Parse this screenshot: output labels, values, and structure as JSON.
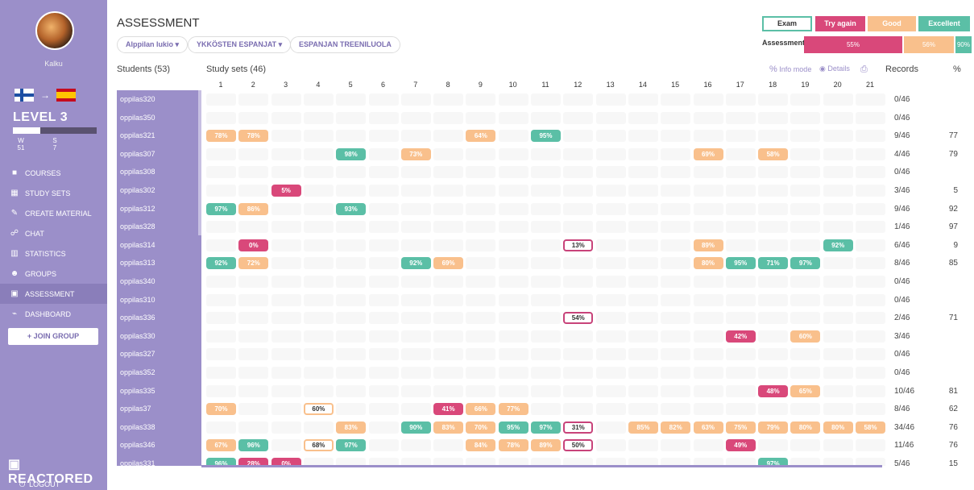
{
  "sidebar": {
    "username": "Kalku",
    "level": "LEVEL 3",
    "w_label": "W",
    "w_value": "51",
    "s_label": "S",
    "s_value": "7",
    "level_progress": 0.33,
    "menu": [
      {
        "label": "COURSES",
        "icon": "courses-icon",
        "glyph": "■"
      },
      {
        "label": "STUDY SETS",
        "icon": "study-sets-icon",
        "glyph": "▦"
      },
      {
        "label": "CREATE MATERIAL",
        "icon": "pencil-icon",
        "glyph": "✎"
      },
      {
        "label": "CHAT",
        "icon": "chat-icon",
        "glyph": "☍"
      },
      {
        "label": "STATISTICS",
        "icon": "statistics-icon",
        "glyph": "▥"
      },
      {
        "label": "GROUPS",
        "icon": "groups-icon",
        "glyph": "☻"
      },
      {
        "label": "ASSESSMENT",
        "icon": "assessment-icon",
        "glyph": "▣"
      },
      {
        "label": "DASHBOARD",
        "icon": "dashboard-icon",
        "glyph": "⌁"
      }
    ],
    "join_group": "+ JOIN GROUP",
    "brand": "REACTORED",
    "logout": "LOGOUT"
  },
  "header": {
    "title": "ASSESSMENT",
    "filters": [
      "Alppilan lukio ▾",
      "YKKÖSTEN ESPANJAT ▾",
      "ESPANJAN TREENILUOLA"
    ],
    "legend": {
      "exam": "Exam",
      "try_again": "Try again",
      "good": "Good",
      "excellent": "Excellent"
    },
    "assessment_label": "Assessment",
    "assessment_try_again": "55%",
    "assessment_good": "56%",
    "assessment_excellent": "90%"
  },
  "table": {
    "students_header": "Students (53)",
    "sets_header": "Study sets (46)",
    "info_mode": "Info mode",
    "details": "Details",
    "records_header": "Records",
    "pct_header": "%",
    "columns": [
      "1",
      "2",
      "3",
      "4",
      "5",
      "6",
      "7",
      "8",
      "9",
      "10",
      "11",
      "12",
      "13",
      "14",
      "15",
      "16",
      "17",
      "18",
      "19",
      "20",
      "21"
    ],
    "rows": [
      {
        "name": "oppilas320",
        "records": "0/46",
        "pct": "",
        "cells": []
      },
      {
        "name": "oppilas350",
        "records": "0/46",
        "pct": "",
        "cells": []
      },
      {
        "name": "oppilas321",
        "records": "9/46",
        "pct": "77",
        "cells": [
          {
            "c": 1,
            "v": "78%",
            "t": "good"
          },
          {
            "c": 2,
            "v": "78%",
            "t": "good"
          },
          {
            "c": 9,
            "v": "64%",
            "t": "good"
          },
          {
            "c": 11,
            "v": "95%",
            "t": "excellent"
          }
        ]
      },
      {
        "name": "oppilas307",
        "records": "4/46",
        "pct": "79",
        "cells": [
          {
            "c": 5,
            "v": "98%",
            "t": "excellent"
          },
          {
            "c": 7,
            "v": "73%",
            "t": "good"
          },
          {
            "c": 16,
            "v": "69%",
            "t": "good"
          },
          {
            "c": 18,
            "v": "58%",
            "t": "good"
          }
        ]
      },
      {
        "name": "oppilas308",
        "records": "0/46",
        "pct": "",
        "cells": []
      },
      {
        "name": "oppilas302",
        "records": "3/46",
        "pct": "5",
        "cells": [
          {
            "c": 3,
            "v": "5%",
            "t": "try"
          }
        ]
      },
      {
        "name": "oppilas312",
        "records": "9/46",
        "pct": "92",
        "cells": [
          {
            "c": 1,
            "v": "97%",
            "t": "excellent"
          },
          {
            "c": 2,
            "v": "86%",
            "t": "good"
          },
          {
            "c": 5,
            "v": "93%",
            "t": "excellent"
          }
        ]
      },
      {
        "name": "oppilas328",
        "records": "1/46",
        "pct": "97",
        "cells": []
      },
      {
        "name": "oppilas314",
        "records": "6/46",
        "pct": "9",
        "cells": [
          {
            "c": 2,
            "v": "0%",
            "t": "try"
          },
          {
            "c": 12,
            "v": "13%",
            "t": "exam"
          },
          {
            "c": 16,
            "v": "89%",
            "t": "good"
          },
          {
            "c": 20,
            "v": "92%",
            "t": "excellent"
          }
        ]
      },
      {
        "name": "oppilas313",
        "records": "8/46",
        "pct": "85",
        "cells": [
          {
            "c": 1,
            "v": "92%",
            "t": "excellent"
          },
          {
            "c": 2,
            "v": "72%",
            "t": "good"
          },
          {
            "c": 7,
            "v": "92%",
            "t": "excellent"
          },
          {
            "c": 8,
            "v": "69%",
            "t": "good"
          },
          {
            "c": 16,
            "v": "80%",
            "t": "good"
          },
          {
            "c": 17,
            "v": "95%",
            "t": "excellent"
          },
          {
            "c": 18,
            "v": "71%",
            "t": "excellent"
          },
          {
            "c": 19,
            "v": "97%",
            "t": "excellent"
          }
        ]
      },
      {
        "name": "oppilas340",
        "records": "0/46",
        "pct": "",
        "cells": []
      },
      {
        "name": "oppilas310",
        "records": "0/46",
        "pct": "",
        "cells": []
      },
      {
        "name": "oppilas336",
        "records": "2/46",
        "pct": "71",
        "cells": [
          {
            "c": 12,
            "v": "54%",
            "t": "exam"
          }
        ]
      },
      {
        "name": "oppilas330",
        "records": "3/46",
        "pct": "",
        "cells": [
          {
            "c": 17,
            "v": "42%",
            "t": "try"
          },
          {
            "c": 19,
            "v": "60%",
            "t": "good"
          }
        ]
      },
      {
        "name": "oppilas327",
        "records": "0/46",
        "pct": "",
        "cells": []
      },
      {
        "name": "oppilas352",
        "records": "0/46",
        "pct": "",
        "cells": []
      },
      {
        "name": "oppilas335",
        "records": "10/46",
        "pct": "81",
        "cells": [
          {
            "c": 18,
            "v": "48%",
            "t": "try"
          },
          {
            "c": 19,
            "v": "65%",
            "t": "good"
          }
        ]
      },
      {
        "name": "oppilas37",
        "records": "8/46",
        "pct": "62",
        "cells": [
          {
            "c": 1,
            "v": "70%",
            "t": "good"
          },
          {
            "c": 4,
            "v": "60%",
            "t": "examgood"
          },
          {
            "c": 8,
            "v": "41%",
            "t": "try"
          },
          {
            "c": 9,
            "v": "66%",
            "t": "good"
          },
          {
            "c": 10,
            "v": "77%",
            "t": "good"
          }
        ]
      },
      {
        "name": "oppilas338",
        "records": "34/46",
        "pct": "76",
        "cells": [
          {
            "c": 5,
            "v": "83%",
            "t": "good"
          },
          {
            "c": 7,
            "v": "90%",
            "t": "excellent"
          },
          {
            "c": 8,
            "v": "83%",
            "t": "good"
          },
          {
            "c": 9,
            "v": "70%",
            "t": "good"
          },
          {
            "c": 10,
            "v": "95%",
            "t": "excellent"
          },
          {
            "c": 11,
            "v": "97%",
            "t": "excellent"
          },
          {
            "c": 12,
            "v": "31%",
            "t": "exam"
          },
          {
            "c": 14,
            "v": "85%",
            "t": "good"
          },
          {
            "c": 15,
            "v": "82%",
            "t": "good"
          },
          {
            "c": 16,
            "v": "63%",
            "t": "good"
          },
          {
            "c": 17,
            "v": "75%",
            "t": "good"
          },
          {
            "c": 18,
            "v": "79%",
            "t": "good"
          },
          {
            "c": 19,
            "v": "80%",
            "t": "good"
          },
          {
            "c": 20,
            "v": "80%",
            "t": "good"
          },
          {
            "c": 21,
            "v": "58%",
            "t": "good"
          }
        ]
      },
      {
        "name": "oppilas346",
        "records": "11/46",
        "pct": "76",
        "cells": [
          {
            "c": 1,
            "v": "67%",
            "t": "good"
          },
          {
            "c": 2,
            "v": "96%",
            "t": "excellent"
          },
          {
            "c": 4,
            "v": "68%",
            "t": "examgood"
          },
          {
            "c": 5,
            "v": "97%",
            "t": "excellent"
          },
          {
            "c": 9,
            "v": "84%",
            "t": "good"
          },
          {
            "c": 10,
            "v": "78%",
            "t": "good"
          },
          {
            "c": 11,
            "v": "89%",
            "t": "good"
          },
          {
            "c": 12,
            "v": "50%",
            "t": "exam"
          },
          {
            "c": 17,
            "v": "49%",
            "t": "try"
          }
        ]
      },
      {
        "name": "oppilas331",
        "records": "5/46",
        "pct": "15",
        "cells": [
          {
            "c": 1,
            "v": "96%",
            "t": "excellent"
          },
          {
            "c": 2,
            "v": "28%",
            "t": "try"
          },
          {
            "c": 3,
            "v": "0%",
            "t": "try"
          },
          {
            "c": 18,
            "v": "97%",
            "t": "excellent"
          }
        ]
      }
    ]
  },
  "colors": {
    "sidebar": "#9b8fc9",
    "try_again": "#d9487a",
    "good": "#f9c08c",
    "excellent": "#5bbfa6",
    "exam_border": "#c8437a"
  }
}
